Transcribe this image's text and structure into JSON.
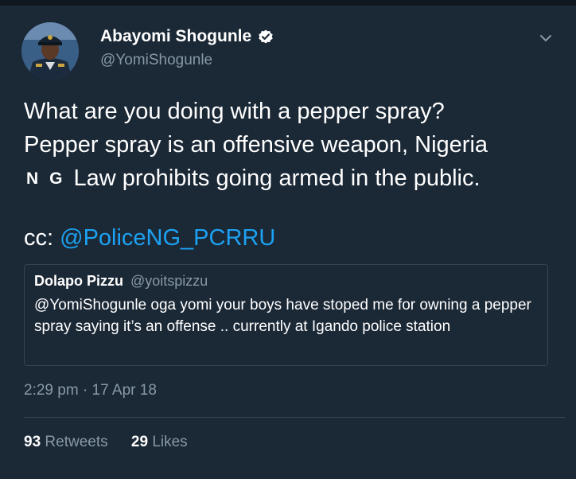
{
  "tweet": {
    "author": {
      "display_name": "Abayomi Shogunle",
      "handle": "@YomiShogunle",
      "verified": true
    },
    "text": {
      "line1": "What are you doing with a pepper spray?",
      "line2": "Pepper spray is an offensive weapon, Nigeria",
      "flag_letter_1": "N",
      "flag_letter_2": "G",
      "line3": "Law prohibits going armed in the public.",
      "cc_prefix": "cc: ",
      "cc_mention": "@PoliceNG_PCRRU"
    },
    "quoted_tweet": {
      "display_name": "Dolapo Pizzu",
      "handle": "@yoitspizzu",
      "text": "@YomiShogunle oga yomi your boys have stoped me for owning a pepper spray saying it’s an offense .. currently at Igando police station"
    },
    "timestamp": "2:29 pm · 17 Apr 18",
    "stats": {
      "retweets_count": "93",
      "retweets_label": " Retweets",
      "likes_count": "29",
      "likes_label": " Likes"
    }
  },
  "icons": {
    "verified": "verified-badge-icon",
    "menu": "chevron-down-icon"
  },
  "colors": {
    "background": "#1b2836",
    "link": "#1da1f2",
    "secondary_text": "#8899a6",
    "border": "#38444d"
  }
}
